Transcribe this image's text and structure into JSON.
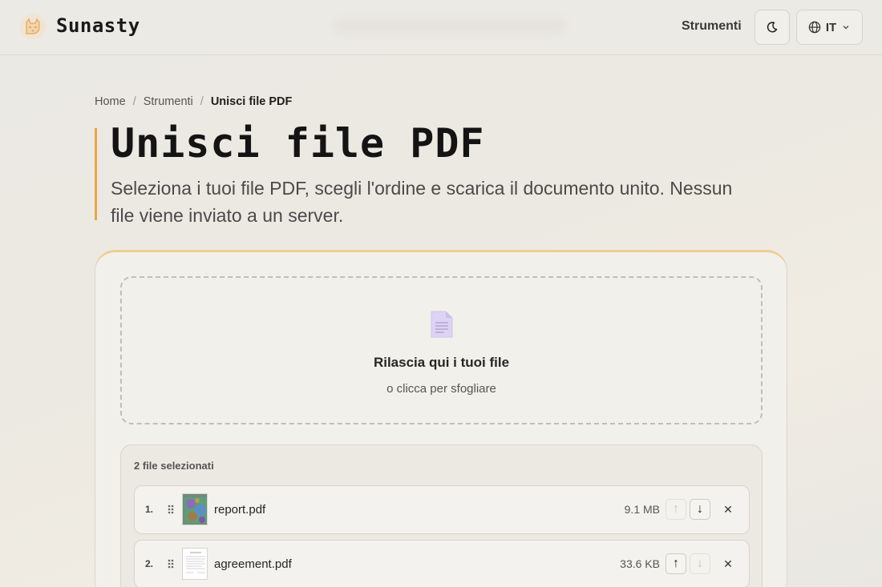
{
  "header": {
    "brand": "Sunasty",
    "nav_tools": "Strumenti",
    "language_code": "IT",
    "icons": {
      "logo": "cat-logo-icon",
      "theme": "moon-icon",
      "lang": "globe-icon",
      "dropdown": "chevron-down-icon"
    }
  },
  "breadcrumb": {
    "items": [
      "Home",
      "Strumenti",
      "Unisci file PDF"
    ],
    "separator": "/"
  },
  "page": {
    "title": "Unisci file PDF",
    "subtitle": "Seleziona i tuoi file PDF, scegli l'ordine e scarica il documento unito. Nessun file viene inviato a un server."
  },
  "dropzone": {
    "title": "Rilascia qui i tuoi file",
    "subtitle": "o clicca per sfogliare",
    "icon": "document-icon"
  },
  "filelist": {
    "count_label": "2 file selezionati",
    "files": [
      {
        "index": "1.",
        "name": "report.pdf",
        "size": "9.1 MB",
        "up_disabled": true,
        "down_disabled": false
      },
      {
        "index": "2.",
        "name": "agreement.pdf",
        "size": "33.6 KB",
        "up_disabled": false,
        "down_disabled": true
      }
    ],
    "move_up_glyph": "↑",
    "move_down_glyph": "↓",
    "remove_glyph": "✕"
  },
  "colors": {
    "accent": "#e8a54a",
    "card_top": "#efcd92",
    "doc_icon": "#c8bde6"
  }
}
